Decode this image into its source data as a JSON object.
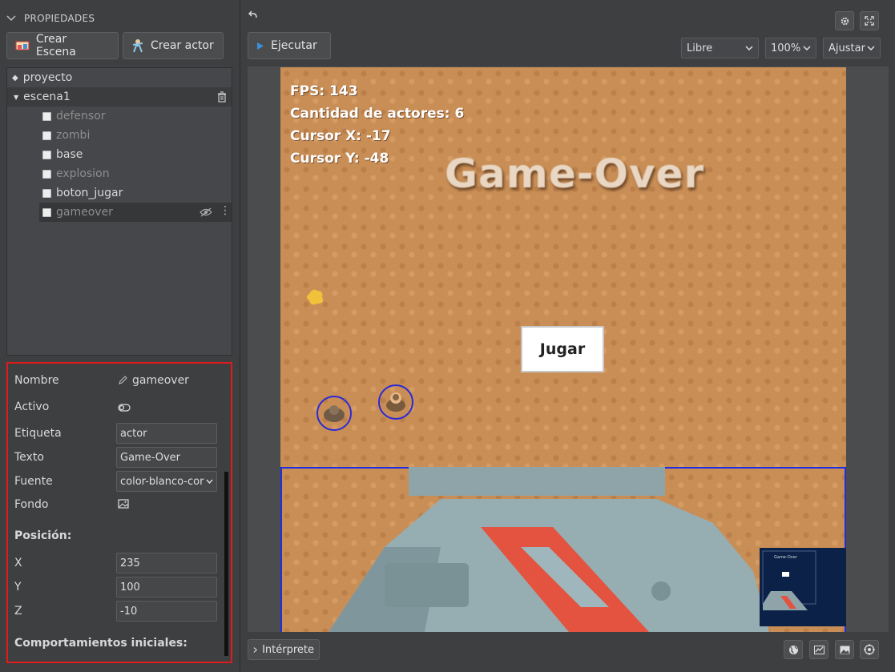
{
  "left_panel": {
    "header": "PROPIEDADES",
    "create_scene": "Crear Escena",
    "create_actor": "Crear actor",
    "tree": {
      "project": "proyecto",
      "scene": "escena1",
      "actors": [
        {
          "name": "defensor",
          "active": false
        },
        {
          "name": "zombi",
          "active": false
        },
        {
          "name": "base",
          "active": true
        },
        {
          "name": "explosion",
          "active": false
        },
        {
          "name": "boton_jugar",
          "active": true
        },
        {
          "name": "gameover",
          "active": false,
          "selected": true
        }
      ]
    }
  },
  "properties": {
    "name_label": "Nombre",
    "name_value": "gameover",
    "active_label": "Activo",
    "tag_label": "Etiqueta",
    "tag_value": "actor",
    "text_label": "Texto",
    "text_value": "Game-Over",
    "font_label": "Fuente",
    "font_value": "color-blanco-cor",
    "background_label": "Fondo",
    "position_heading": "Posición:",
    "x_label": "X",
    "x_value": "235",
    "y_label": "Y",
    "y_value": "100",
    "z_label": "Z",
    "z_value": "-10",
    "behaviours_heading": "Comportamientos iniciales:"
  },
  "toolbar": {
    "run_label": "Ejecutar",
    "mode_select": "Libre",
    "zoom_select": "100%",
    "fit_select": "Ajustar"
  },
  "game": {
    "fps": "FPS: 143",
    "actors_count": "Cantidad de actores: 6",
    "cursor_x": "Cursor X: -17",
    "cursor_y": "Cursor Y: -48",
    "title": "Game-Over",
    "play_button": "Jugar",
    "minimap_title": "Game-Over"
  },
  "bottom": {
    "interpreter": "Intérprete"
  },
  "colors": {
    "accent_blue": "#3c8fd8",
    "selection_red": "#e01b1b",
    "ground": "#c98e56"
  }
}
